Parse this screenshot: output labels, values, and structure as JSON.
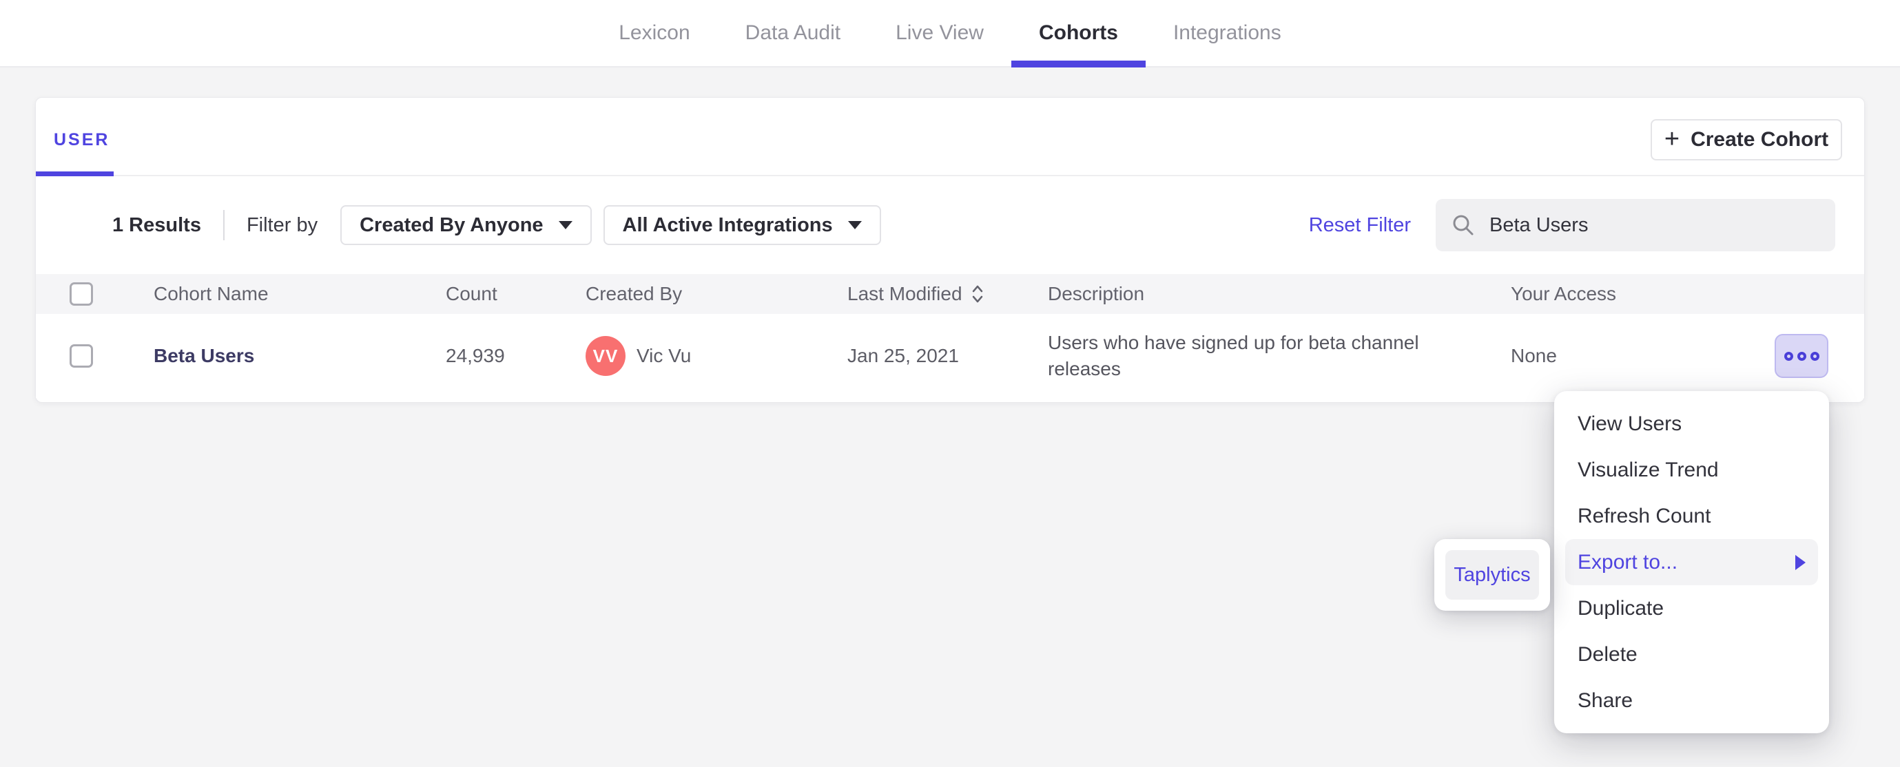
{
  "nav": {
    "tabs": [
      {
        "label": "Lexicon"
      },
      {
        "label": "Data Audit"
      },
      {
        "label": "Live View"
      },
      {
        "label": "Cohorts"
      },
      {
        "label": "Integrations"
      }
    ],
    "active_tab": "Cohorts"
  },
  "panel": {
    "user_tab_label": "USER",
    "create_cohort": {
      "plus": "+",
      "label": "Create Cohort"
    },
    "filter_bar": {
      "results_count": "1 Results",
      "filter_by_label": "Filter by",
      "created_by_dropdown": "Created By Anyone",
      "integrations_dropdown": "All Active Integrations",
      "reset_filter_label": "Reset Filter",
      "search_value": "Beta Users",
      "search_icon": "magnifier"
    },
    "table": {
      "header": {
        "cohort_name": "Cohort Name",
        "count": "Count",
        "created_by": "Created By",
        "last_modified": "Last Modified",
        "description": "Description",
        "your_access": "Your Access",
        "sort_icon": "sort-chevrons"
      },
      "row": {
        "cohort_name": "Beta Users",
        "count": "24,939",
        "avatar_initials": "VV",
        "created_by": "Vic Vu",
        "last_modified": "Jan 25, 2021",
        "description": "Users who have signed up for beta channel releases",
        "your_access": "None",
        "actions_icon": "more-options"
      }
    }
  },
  "context_menu": {
    "items": [
      {
        "label": "View Users"
      },
      {
        "label": "Visualize Trend"
      },
      {
        "label": "Refresh Count"
      },
      {
        "label": "Export to...",
        "highlighted": true,
        "has_submenu": true
      },
      {
        "label": "Duplicate"
      },
      {
        "label": "Delete"
      },
      {
        "label": "Share"
      }
    ]
  },
  "export_submenu": {
    "items": [
      {
        "label": "Taplytics"
      }
    ]
  },
  "colors": {
    "accent": "#4f44e0",
    "avatar_background": "#f87070",
    "cohort_link_text": "#3d3b64",
    "more_button_background": "#dad7f6",
    "page_background": "#f4f4f5",
    "table_header_background": "#f5f5f7"
  }
}
